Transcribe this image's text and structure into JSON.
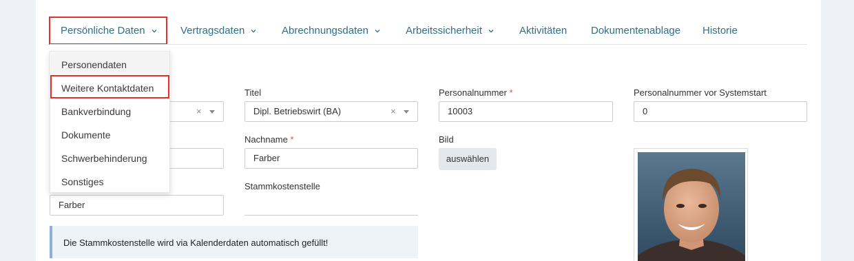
{
  "tabs": [
    {
      "label": "Persönliche Daten",
      "has_dropdown": true
    },
    {
      "label": "Vertragsdaten",
      "has_dropdown": true
    },
    {
      "label": "Abrechnungsdaten",
      "has_dropdown": true
    },
    {
      "label": "Arbeitssicherheit",
      "has_dropdown": true
    },
    {
      "label": "Aktivitäten",
      "has_dropdown": false
    },
    {
      "label": "Dokumentenablage",
      "has_dropdown": false
    },
    {
      "label": "Historie",
      "has_dropdown": false
    }
  ],
  "dropdown": {
    "items": [
      "Personendaten",
      "Weitere Kontaktdaten",
      "Bankverbindung",
      "Dokumente",
      "Schwerbehinderung",
      "Sonstiges"
    ]
  },
  "form": {
    "titel_label": "Titel",
    "titel_value": "Dipl. Betriebswirt (BA)",
    "personalnummer_label": "Personalnummer",
    "personalnummer_value": "10003",
    "personalnummer_vor_label": "Personalnummer vor Systemstart",
    "personalnummer_vor_value": "0",
    "nachname_label": "Nachname",
    "nachname_value": "Farber",
    "bild_label": "Bild",
    "bild_button": "auswählen",
    "stammkostenstelle_label": "Stammkostenstelle",
    "left_name_value": "Farber",
    "required_mark": "*",
    "clear_mark": "×"
  },
  "info_text": "Die Stammkostenstelle wird via Kalenderdaten automatisch gefüllt!",
  "colors": {
    "accent": "#2f6f86",
    "highlight_border": "#e0322b",
    "required": "#d9534f"
  }
}
